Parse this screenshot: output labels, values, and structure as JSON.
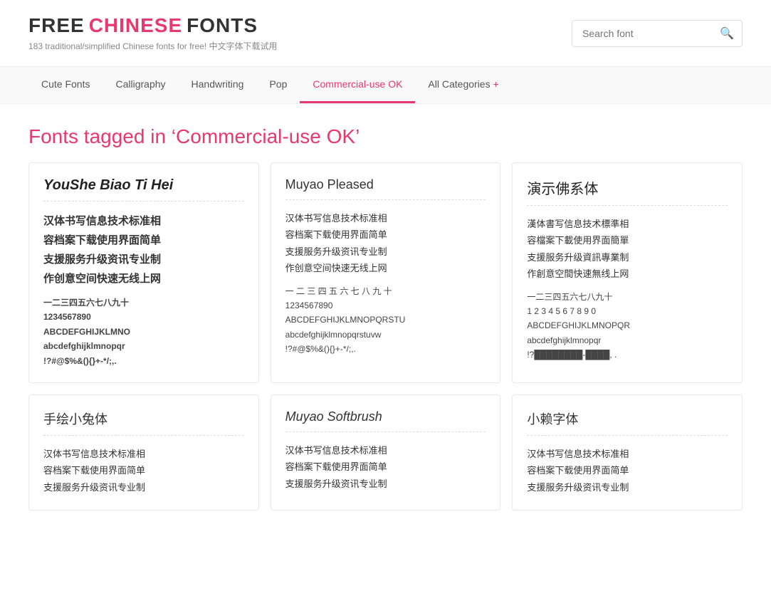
{
  "header": {
    "logo_free": "FREE",
    "logo_chinese": "CHINESE",
    "logo_fonts": "FONTS",
    "tagline": "183 traditional/simplified Chinese fonts for free! 中文字体下载试用",
    "search_placeholder": "Search font"
  },
  "nav": {
    "items": [
      {
        "label": "Cute Fonts",
        "active": false
      },
      {
        "label": "Calligraphy",
        "active": false
      },
      {
        "label": "Handwriting",
        "active": false
      },
      {
        "label": "Pop",
        "active": false
      },
      {
        "label": "Commercial-use OK",
        "active": true
      },
      {
        "label": "All Categories",
        "active": false,
        "suffix": "+"
      }
    ]
  },
  "page": {
    "title_before": "Fonts tagged in ‘",
    "title_highlight": "Commercial-use OK",
    "title_after": "’"
  },
  "fonts": [
    {
      "id": "youshe",
      "name": "YouShe Biao Ti Hei",
      "name_style": "bold-italic",
      "preview_chinese": "汉体书写信息技术标准相容档案下载使用界面简单支援服务升级资讯专业制作创意空间快速无线上网",
      "preview_numbers": "一二三四五六七八九十\n1234567890",
      "preview_alpha": "ABCDEFGHIJKLMNO\nabcdefghijklmnopqr\n!?#@$%&(){}+-*/;,."
    },
    {
      "id": "muyao-pleased",
      "name": "Muyao Pleased",
      "name_style": "normal",
      "preview_chinese": "汉体书写信息技术标准相容档案下载使用界面简单支援服务升级资讯专业制作创意空间快速无线上网",
      "preview_numbers": "一 二 三 四 五 六 七 八 九 十\n1234567890",
      "preview_alpha": "ABCDEFGHIJKLMNOPQRSTU\nabcdefghijklmnopqrstuvw\n!?#@$%&(){}+-*/;,."
    },
    {
      "id": "yanshi",
      "name": "演示佛系体",
      "name_style": "normal",
      "preview_chinese": "漢体書写信息技术標準相容檔案下載使用界面簡單支援服务升级資訊專業制作創意空間快速無线上网",
      "preview_numbers": "一二三四五六七八九十\n1234567890",
      "preview_alpha": "ABCDEFGHIJKLMNOPQR\nabcdefghijklmnopqr\n!?▓▓▓▓▓▓▓▓-▓▓▓▓, ."
    },
    {
      "id": "xiaotu",
      "name": "手绘小兔体",
      "name_style": "normal",
      "preview_chinese": "汉体书写信息技术标准相容档案下载使用界面简单支援服务升级资讯专业制"
    },
    {
      "id": "muyao-softbrush",
      "name": "Muyao Softbrush",
      "name_style": "italic",
      "preview_chinese": "汉体书写信息技术标准相容档案下载使用界面简单支援服务升级资讯专业制"
    },
    {
      "id": "xiaolai",
      "name": "小赖字体",
      "name_style": "normal",
      "preview_chinese": "汉体书写信息技术标准相容档案下载使用界面简单支援服务升级资讯专业制"
    }
  ]
}
